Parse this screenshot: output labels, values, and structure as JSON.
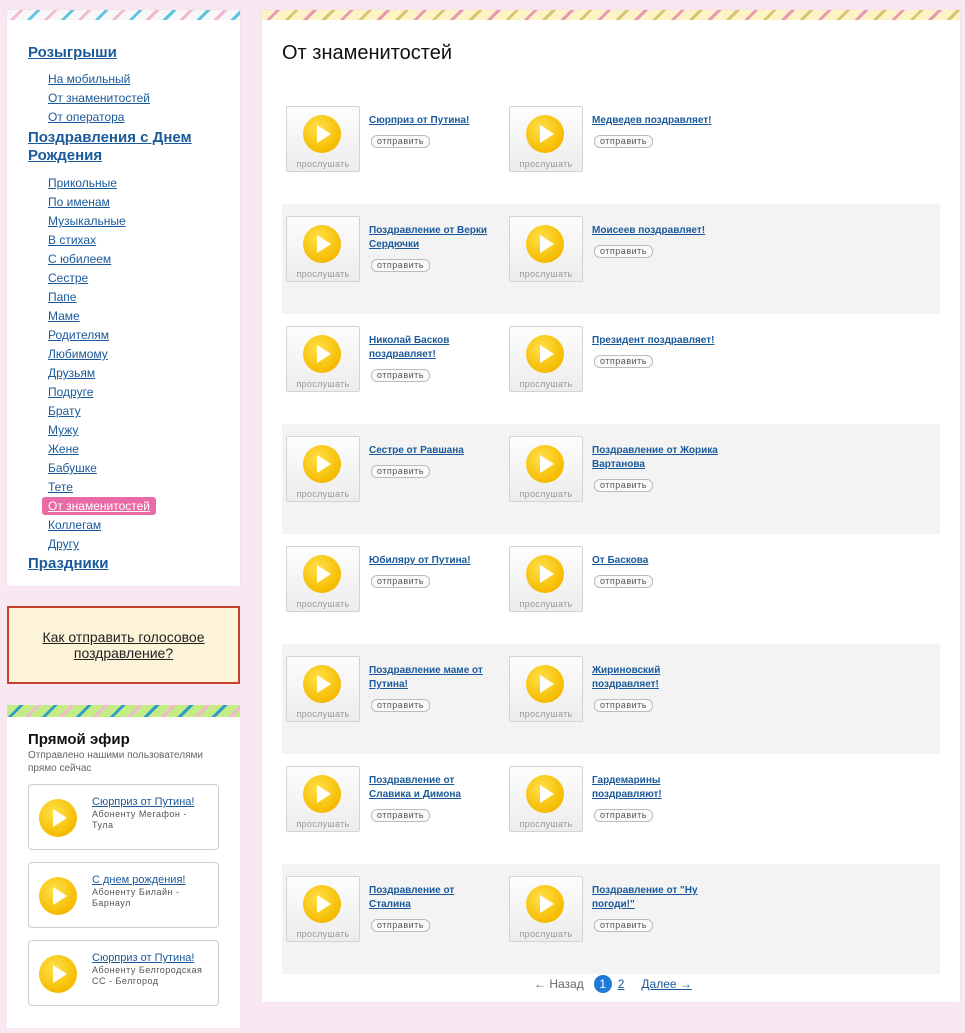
{
  "nav": {
    "section1": "Розыгрыши",
    "section1_items": [
      "На мобильный",
      "От знаменитостей",
      "От оператора"
    ],
    "section2": "Поздравления с Днем Рождения",
    "section2_items": [
      "Прикольные",
      "По именам",
      "Музыкальные",
      "В стихах",
      "С юбилеем",
      "Сестре",
      "Папе",
      "Маме",
      "Родителям",
      "Любимому",
      "Друзьям",
      "Подруге",
      "Брату",
      "Мужу",
      "Жене",
      "Бабушке",
      "Тете",
      "От знаменитостей",
      "Коллегам",
      "Другу"
    ],
    "section2_active": "От знаменитостей",
    "section3": "Праздники"
  },
  "howto": {
    "label": "Как отправить голосовое поздравление?"
  },
  "live": {
    "title": "Прямой эфир",
    "subtitle": "Отправлено нашими пользователями прямо сейчас",
    "items": [
      {
        "title": "Сюрприз от Путина!",
        "desc": "Абоненту Мегафон - Тула"
      },
      {
        "title": "С днем рождения!",
        "desc": "Абоненту Билайн - Барнаул"
      },
      {
        "title": "Сюрприз от Путина!",
        "desc": "Абоненту Белгородская СС - Белгород"
      }
    ]
  },
  "main": {
    "title": "От знаменитостей",
    "listen_label": "прослушать",
    "send_label": "отправить",
    "items": [
      "Сюрприз от Путина!",
      "Медведев поздравляет!",
      "Поздравление от Верки Сердючки",
      "Моисеев поздравляет!",
      "Николай Басков поздравляет!",
      "Президент поздравляет!",
      "Сестре от Равшана",
      "Поздравление от Жорика Вартанова",
      "Юбиляру от Путина!",
      "От Баскова",
      "Поздравление маме от Путина!",
      "Жириновский поздравляет!",
      "Поздравление от Славика и Димона",
      "Гардемарины поздравляют!",
      "Поздравление от Сталина",
      "Поздравление от \"Ну погоди!\""
    ]
  },
  "pager": {
    "prev": "← Назад",
    "current": "1",
    "page2": "2",
    "next": "Далее →"
  }
}
